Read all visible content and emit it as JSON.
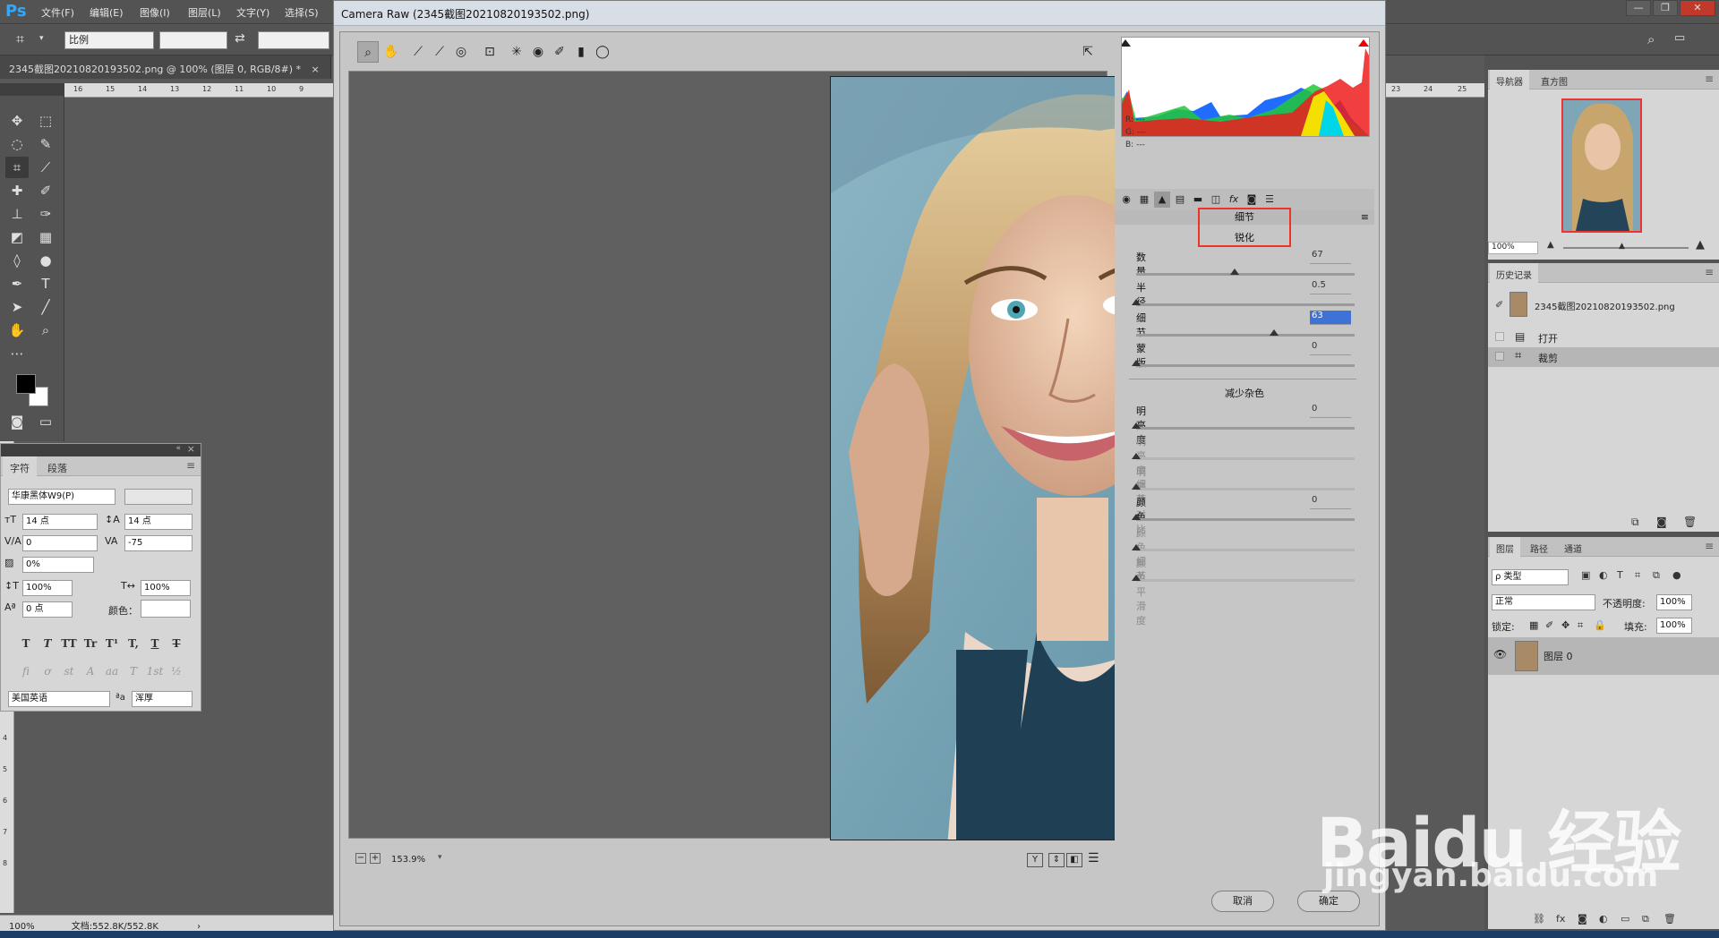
{
  "app": {
    "logo": "Ps",
    "menus": [
      "文件(F)",
      "编辑(E)",
      "图像(I)",
      "图层(L)",
      "文字(Y)",
      "选择(S)"
    ],
    "window_controls": [
      "—",
      "❐",
      "✕"
    ]
  },
  "options_bar": {
    "ratio_label": "比例"
  },
  "document": {
    "tab_title": "2345截图20210820193502.png @ 100% (图层 0, RGB/8#) *",
    "ruler_top_left": [
      "16",
      "15",
      "14",
      "13",
      "12",
      "11",
      "10",
      "9"
    ],
    "ruler_top_right": [
      "23",
      "24",
      "25"
    ],
    "ruler_left": [
      "4",
      "5",
      "6",
      "7",
      "8"
    ]
  },
  "status_bar": {
    "zoom": "100%",
    "doc_info": "文档:552.8K/552.8K"
  },
  "char_panel": {
    "tabs": [
      "字符",
      "段落"
    ],
    "font_family": "华康黑体W9(P)",
    "font_size": "14 点",
    "leading": "14 点",
    "kerning": "0",
    "tracking": "-75",
    "tsume": "0%",
    "vscale": "100%",
    "hscale": "100%",
    "baseline": "0 点",
    "color_label": "颜色：",
    "language": "美国英语",
    "aa_label": "ªa",
    "antialias": "浑厚",
    "format_buttons": [
      "T",
      "T",
      "TT",
      "Tr",
      "T¹",
      "T,",
      "T",
      "T"
    ],
    "opentype_buttons": [
      "fi",
      "ơ",
      "st",
      "A",
      "aa",
      "T",
      "1st",
      "½"
    ]
  },
  "camera_raw": {
    "title": "Camera Raw (2345截图20210820193502.png)",
    "histogram_rgb": [
      "R:  ---",
      "G:  ---",
      "B:  ---"
    ],
    "panel_title": "细节",
    "sharpen": {
      "title": "锐化",
      "sliders": [
        {
          "label": "数量",
          "value": "67",
          "fraction": 0.45,
          "enabled": true
        },
        {
          "label": "半径",
          "value": "0.5",
          "fraction": 0.0,
          "enabled": true
        },
        {
          "label": "细节",
          "value": "63",
          "fraction": 0.63,
          "enabled": true,
          "active": true
        },
        {
          "label": "蒙版",
          "value": "0",
          "fraction": 0.0,
          "enabled": true
        }
      ]
    },
    "noise": {
      "title": "减少杂色",
      "sliders": [
        {
          "label": "明亮度",
          "value": "0",
          "fraction": 0.0,
          "enabled": true
        },
        {
          "label": "明亮度细节",
          "value": "",
          "fraction": 0.0,
          "enabled": false
        },
        {
          "label": "明亮度对比",
          "value": "",
          "fraction": 0.0,
          "enabled": false
        },
        {
          "label": "颜色",
          "value": "0",
          "fraction": 0.0,
          "enabled": true
        },
        {
          "label": "颜色细节",
          "value": "",
          "fraction": 0.0,
          "enabled": false
        },
        {
          "label": "颜色平滑度",
          "value": "",
          "fraction": 0.0,
          "enabled": false
        }
      ]
    },
    "zoom": "153.9%",
    "cancel_label": "取消",
    "ok_label": "确定"
  },
  "right_panels": {
    "navigator_tabs": [
      "导航器",
      "直方图"
    ],
    "nav_zoom": "100%",
    "history_tab": "历史记录",
    "history_snapshot": "2345截图20210820193502.png",
    "history_items": [
      "打开",
      "裁剪"
    ],
    "layers_tabs": [
      "图层",
      "路径",
      "通道"
    ],
    "filter_kind": "ρ 类型",
    "blend_mode": "正常",
    "opacity_label": "不透明度:",
    "opacity": "100%",
    "lock_label": "锁定:",
    "fill_label": "填充:",
    "fill": "100%",
    "layer_name": "图层 0"
  },
  "watermark": {
    "brand": "Baidu 经验",
    "url": "jingyan.baidu.com"
  }
}
